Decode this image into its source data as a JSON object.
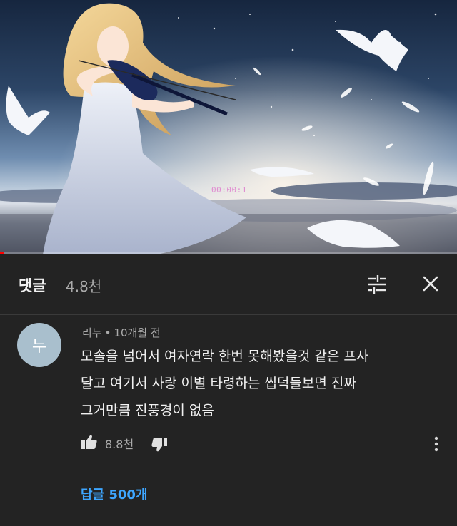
{
  "video": {
    "timestamp": "00:00:1",
    "progress": 0.01
  },
  "comments_header": {
    "title": "댓글",
    "count": "4.8천",
    "sort_icon": "sort-sliders-icon",
    "close_icon": "close-icon"
  },
  "comment": {
    "avatar_letter": "누",
    "author": "리누",
    "separator": "•",
    "time": "10개월 전",
    "body_lines": [
      "모솔을 넘어서 여자연락 한번 못해봤을것 같은 프사",
      "달고 여기서 사랑 이별 타령하는 씹덕들보면  진짜",
      "그거만큼 진풍경이 없음"
    ],
    "likes": "8.8천",
    "replies_label": "답글 500개"
  },
  "colors": {
    "background": "#232323",
    "avatar": "#a9bfcd",
    "link": "#3ea6ff",
    "progress": "#ff0000"
  }
}
